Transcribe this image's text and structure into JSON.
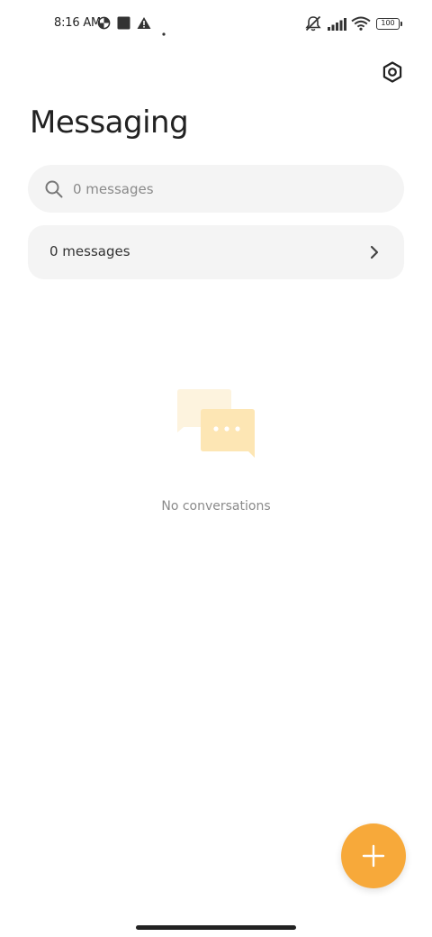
{
  "status_bar": {
    "time": "8:16 AM",
    "battery_level": "100",
    "left_icons": [
      "data-saver-icon",
      "square-notification-icon",
      "warning-icon",
      "dot-icon"
    ],
    "right_icons": [
      "silent-icon",
      "signal-icon",
      "wifi-icon",
      "battery-icon"
    ]
  },
  "header": {
    "title": "Messaging",
    "settings_icon": "settings-icon"
  },
  "search": {
    "placeholder": "0 messages",
    "value": "",
    "icon": "search-icon"
  },
  "messages_row": {
    "label": "0 messages",
    "icon": "chevron-right-icon"
  },
  "empty_state": {
    "text": "No conversations",
    "icon": "chat-bubbles-icon"
  },
  "fab": {
    "icon": "plus-icon"
  },
  "colors": {
    "accent": "#f7a93a",
    "surface": "#f4f4f4",
    "text_primary": "#222222",
    "text_secondary": "#8a8a8a"
  }
}
